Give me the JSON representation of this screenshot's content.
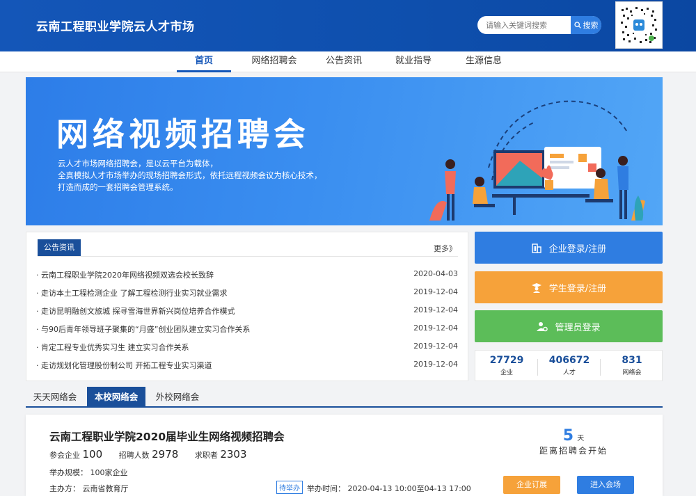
{
  "header": {
    "site_title": "云南工程职业学院云人才市场",
    "search_placeholder": "请输入关键词搜索",
    "search_label": "搜索"
  },
  "nav": {
    "items": [
      "首页",
      "网络招聘会",
      "公告资讯",
      "就业指导",
      "生源信息"
    ]
  },
  "banner": {
    "title": "网络视频招聘会",
    "desc": [
      "云人才市场网络招聘会，是以云平台为载体，",
      "全真模拟人才市场举办的现场招聘会形式，依托远程视频会议为核心技术，",
      "打造而成的一套招聘会管理系统。"
    ]
  },
  "notice": {
    "tab": "公告资讯",
    "more": "更多》",
    "items": [
      {
        "title": "· 云南工程职业学院2020年网络视频双选会校长致辞",
        "date": "2020-04-03"
      },
      {
        "title": "· 走访本土工程检测企业 了解工程检测行业实习就业需求",
        "date": "2019-12-04"
      },
      {
        "title": "· 走访昆明融创文旅城 探寻雪海世界新兴岗位培养合作模式",
        "date": "2019-12-04"
      },
      {
        "title": "· 与90后青年领导班子聚集的“月盛”创业团队建立实习合作关系",
        "date": "2019-12-04"
      },
      {
        "title": "· 肯定工程专业优秀实习生 建立实习合作关系",
        "date": "2019-12-04"
      },
      {
        "title": "· 走访规划化管理股份制公司 开拓工程专业实习渠道",
        "date": "2019-12-04"
      }
    ]
  },
  "actions": {
    "enterprise": "企业登录/注册",
    "student": "学生登录/注册",
    "admin": "管理员登录"
  },
  "stats": [
    {
      "value": "27729",
      "label": "企业"
    },
    {
      "value": "406672",
      "label": "人才"
    },
    {
      "value": "831",
      "label": "网络会"
    }
  ],
  "tabs": [
    "天天网络会",
    "本校网络会",
    "外校网络会"
  ],
  "fair": {
    "title": "云南工程职业学院2020届毕业生网络视频招聘会",
    "companies_label": "参会企业",
    "companies": "100",
    "recruits_label": "招聘人数",
    "recruits": "2978",
    "seekers_label": "求职者",
    "seekers": "2303",
    "scale": "举办规模：   100家企业",
    "organizer": "主办方：   云南省教育厅",
    "status_tag": "待举办",
    "time": "举办时间：  2020-04-13 10:00至04-13 17:00",
    "countdown_value": "5",
    "countdown_unit": "天",
    "countdown_text": "距离招聘会开始",
    "subscribe": "企业订展",
    "enter": "进入会场"
  },
  "colors": {
    "header_blue": "#1456b8",
    "accent_blue": "#2f7de1",
    "dark_blue": "#1a4f9a",
    "orange": "#f6a23a",
    "green": "#5cbd59"
  }
}
